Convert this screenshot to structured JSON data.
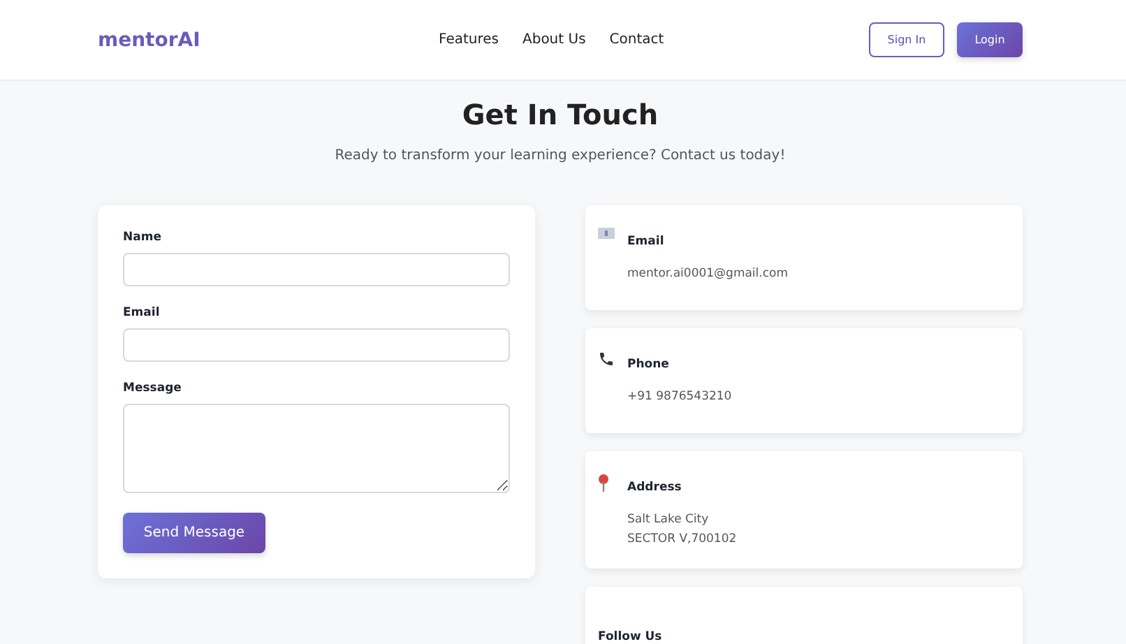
{
  "header": {
    "logo": "mentorAI",
    "nav": [
      {
        "label": "Features"
      },
      {
        "label": "About Us"
      },
      {
        "label": "Contact"
      }
    ],
    "sign_in": "Sign In",
    "login": "Login"
  },
  "title": "Get In Touch",
  "subtitle": "Ready to transform your learning experience? Contact us today!",
  "form": {
    "fields": [
      {
        "label": "Name",
        "kind": "input"
      },
      {
        "label": "Email",
        "kind": "input"
      },
      {
        "label": "Message",
        "kind": "textarea"
      }
    ],
    "submit": "Send Message"
  },
  "contacts": [
    {
      "kind": "email",
      "title": "Email",
      "lines": [
        "mentor.ai0001@gmail.com"
      ]
    },
    {
      "kind": "phone",
      "title": "Phone",
      "lines": [
        "+91 9876543210"
      ]
    },
    {
      "kind": "address",
      "title": "Address",
      "lines": [
        "Salt Lake City",
        "SECTOR V,700102"
      ]
    },
    {
      "kind": "social",
      "title": "Follow Us"
    }
  ]
}
